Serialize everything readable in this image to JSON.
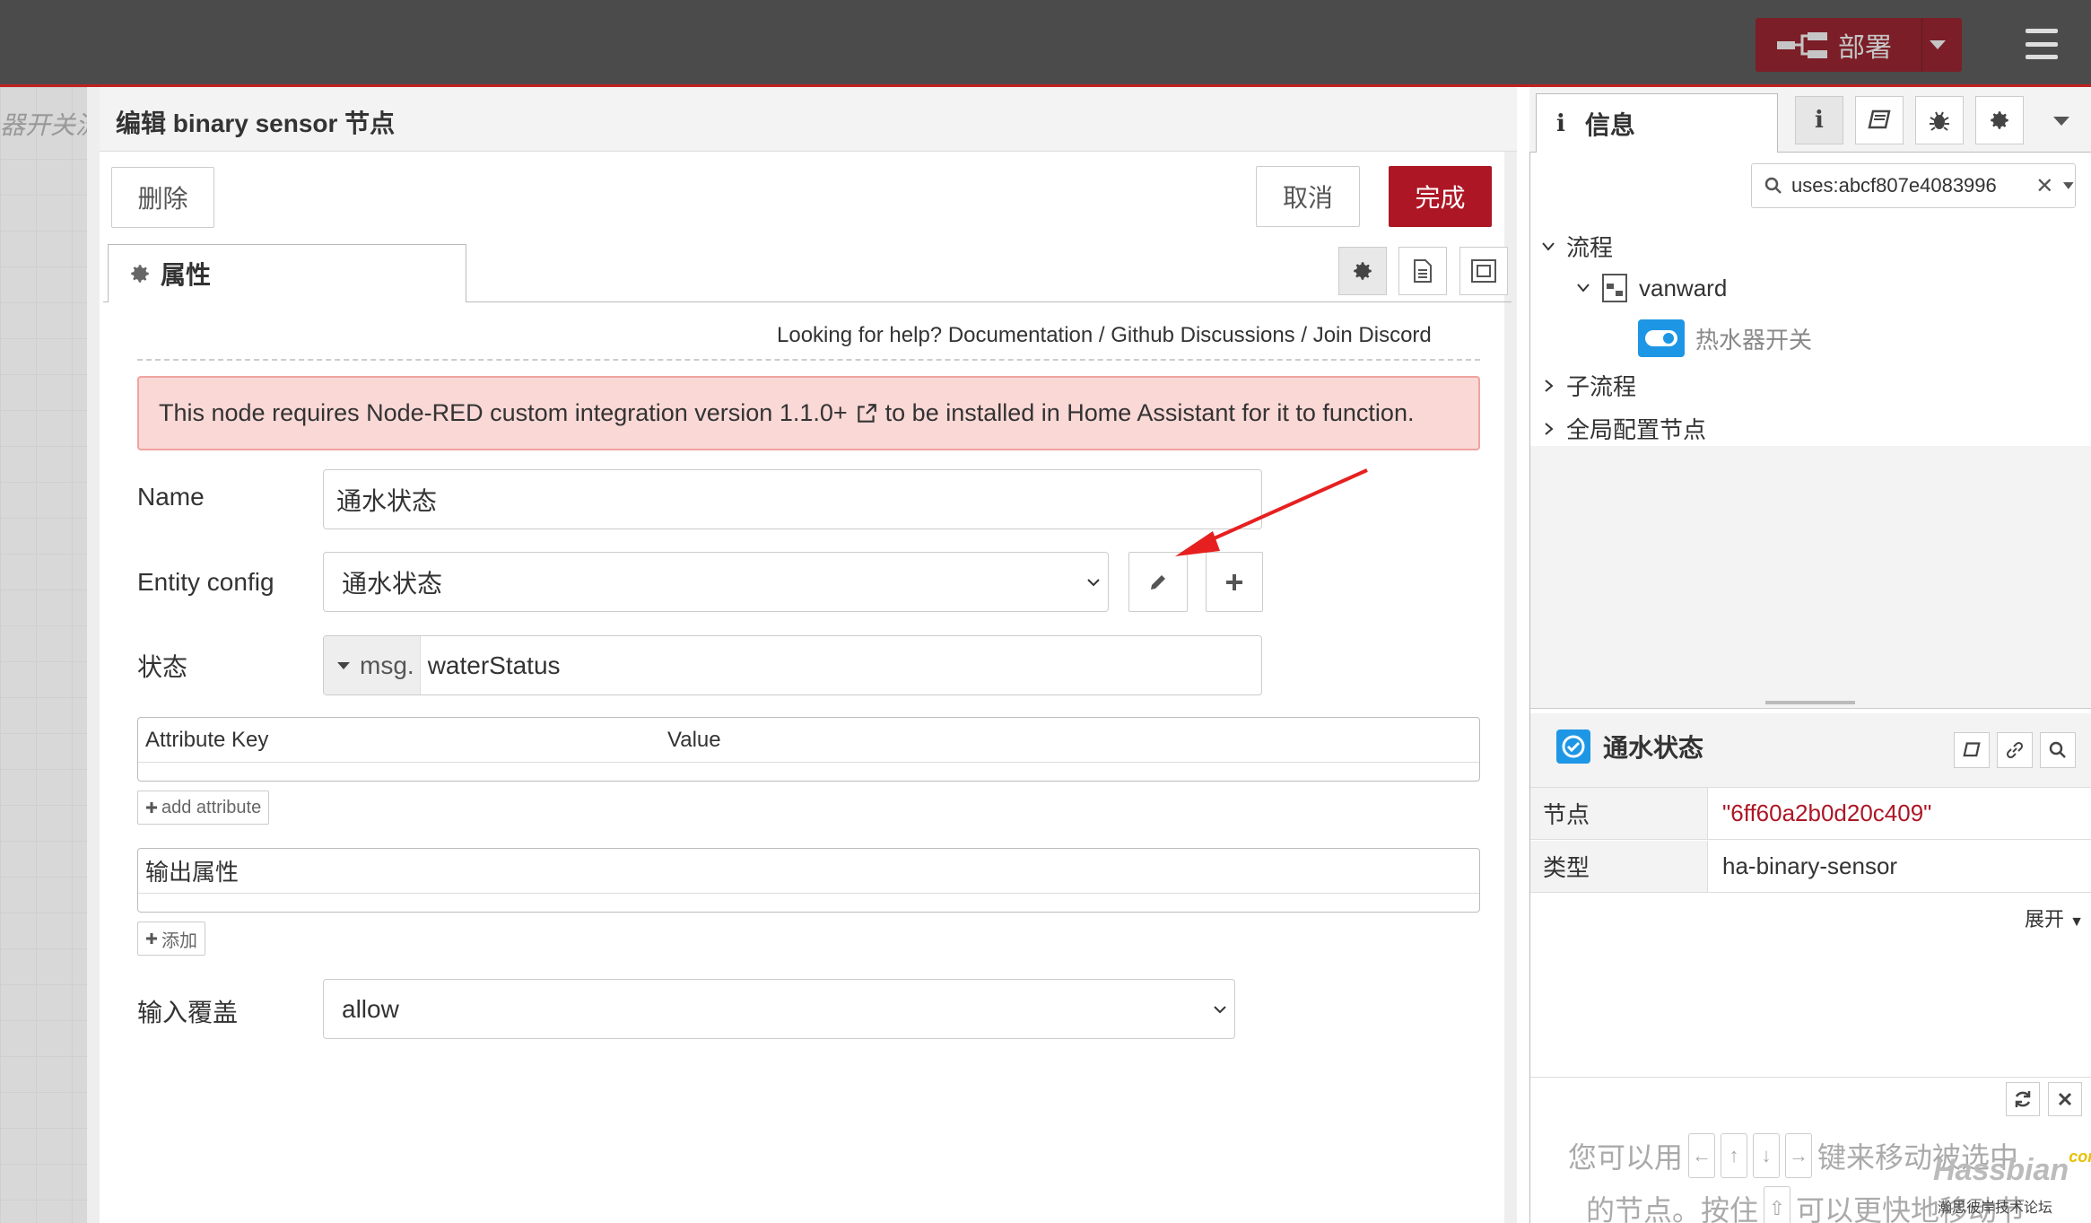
{
  "header": {
    "deploy_label": "部署"
  },
  "workspace": {
    "partial_label": "器开关流"
  },
  "tray": {
    "title": "编辑 binary sensor 节点",
    "delete_label": "删除",
    "cancel_label": "取消",
    "done_label": "完成",
    "tab_properties": "属性",
    "help": {
      "prefix": "Looking for help?",
      "links": [
        "Documentation",
        "Github Discussions",
        "Join Discord"
      ],
      "separator": "/"
    },
    "warning": {
      "before": "This node requires Node-RED custom integration version 1.1.0+",
      "after": "to be installed in Home Assistant for it to function."
    },
    "fields": {
      "name": {
        "label": "Name",
        "value": "通水状态"
      },
      "entity_config": {
        "label": "Entity config",
        "value": "通水状态"
      },
      "state": {
        "label": "状态",
        "type_prefix": "msg.",
        "value": "waterStatus"
      },
      "attributes": {
        "col_key": "Attribute Key",
        "col_value": "Value",
        "add_label": "add attribute"
      },
      "output": {
        "header": "输出属性",
        "add_label": "添加"
      },
      "input_override": {
        "label": "输入覆盖",
        "value": "allow"
      }
    }
  },
  "sidebar": {
    "tab_info": "信息",
    "search_value": "uses:abcf807e4083996",
    "tree": {
      "flows": "流程",
      "flow_name": "vanward",
      "node_name": "热水器开关",
      "subflows": "子流程",
      "config_nodes": "全局配置节点"
    },
    "node": {
      "title": "通水状态",
      "props": [
        {
          "key": "节点",
          "value": "\"6ff60a2b0d20c409\""
        },
        {
          "key": "类型",
          "value": "ha-binary-sensor"
        }
      ],
      "expand_label": "展开"
    },
    "tips": {
      "line1_a": "您可以用",
      "line1_b": "键来移动被选中",
      "line2_a": "的节点。按住",
      "line2_b": "可以更快地移动节"
    }
  },
  "watermark": {
    "brand": "Hassbian",
    "com": "com",
    "subtitle": "瀚思彼岸技术论坛"
  },
  "colors": {
    "accent": "#ad1625",
    "header": "#4b4b4b",
    "node_id": "#ad1625",
    "toggle": "#1e96e6"
  }
}
